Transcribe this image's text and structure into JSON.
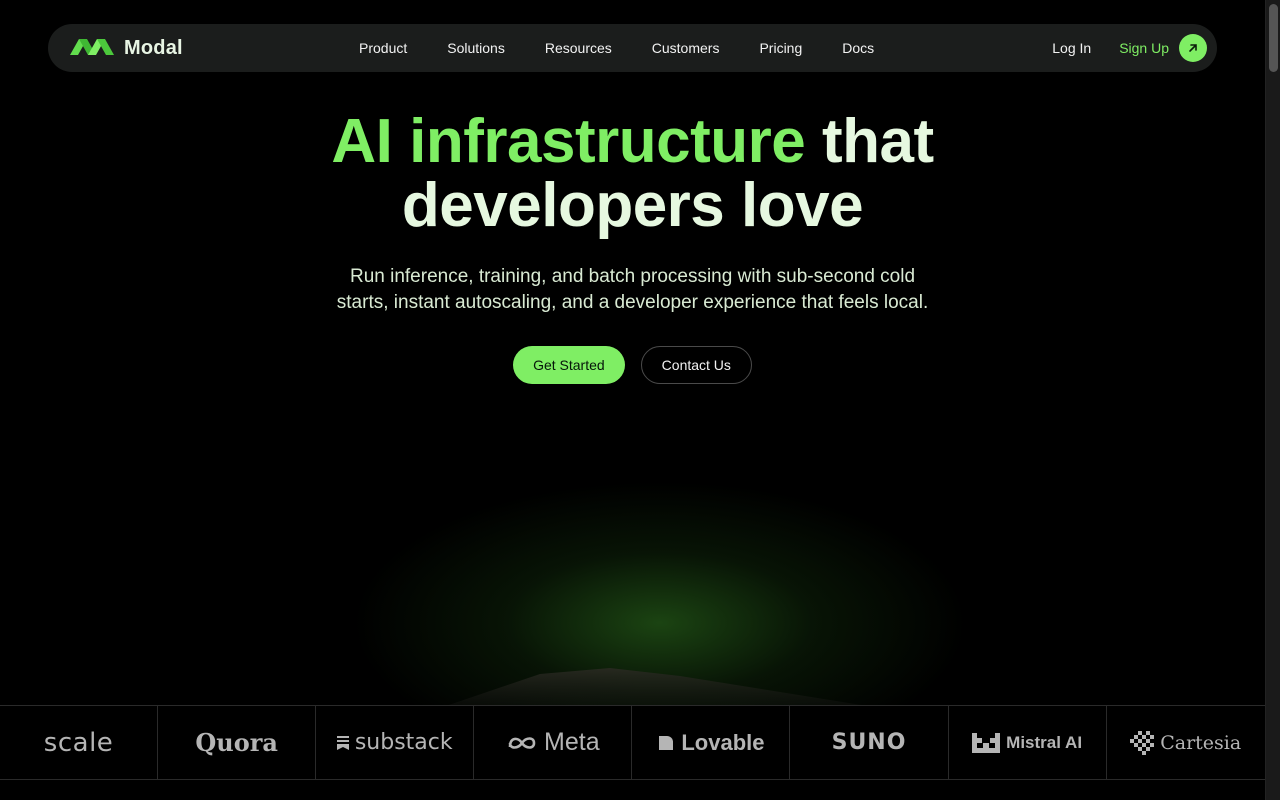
{
  "brand": {
    "name": "Modal",
    "logo_icon": "modal-logo-icon",
    "accent_color": "#7fee64"
  },
  "nav": {
    "links": [
      "Product",
      "Solutions",
      "Resources",
      "Customers",
      "Pricing",
      "Docs"
    ],
    "login_label": "Log In",
    "signup_label": "Sign Up",
    "signup_icon": "arrow-up-right-icon"
  },
  "hero": {
    "headline_accent": "AI infrastructure",
    "headline_rest_line1": "that",
    "headline_line2": "developers love",
    "subtitle_line1": "Run inference, training, and batch processing with sub-second cold",
    "subtitle_line2": "starts, instant autoscaling, and a developer experience that feels local.",
    "primary_cta": "Get Started",
    "secondary_cta": "Contact Us"
  },
  "customers": {
    "logos": [
      "scale",
      "Quora",
      "substack",
      "Meta",
      "Lovable",
      "SUNO",
      "Mistral AI",
      "Cartesia"
    ]
  }
}
